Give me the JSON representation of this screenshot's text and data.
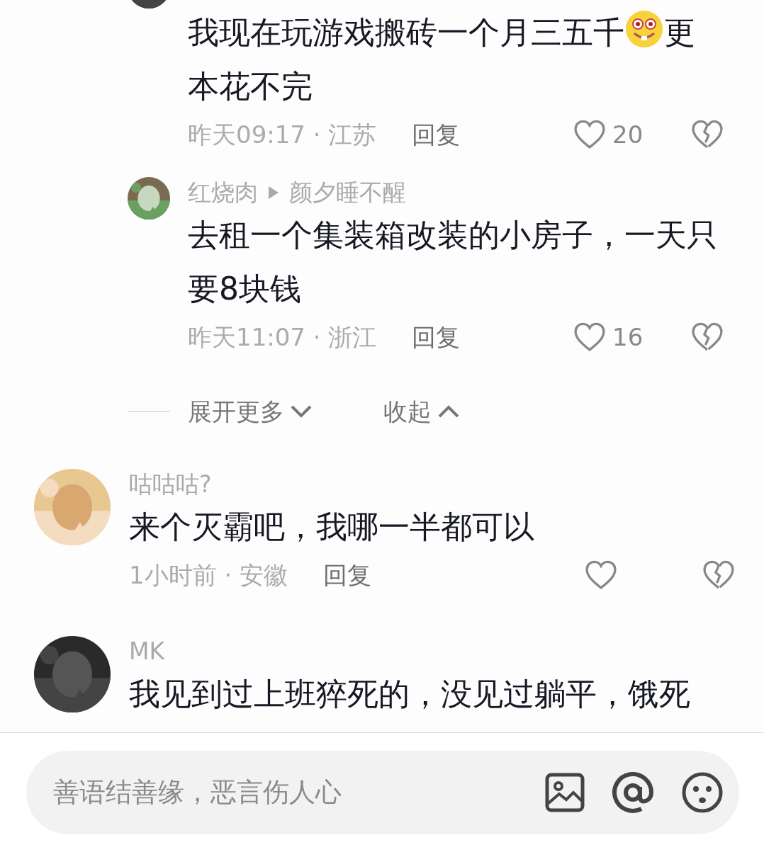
{
  "comments": [
    {
      "kind": "reply",
      "segments": [
        {
          "kind": "text",
          "text": "我现在玩游戏搬砖一个月三五千"
        },
        {
          "kind": "emoji"
        },
        {
          "kind": "text",
          "text": "更本花不完"
        }
      ],
      "time_place": "昨天09:17 · 江苏",
      "reply_label": "回复",
      "likes": "20"
    },
    {
      "kind": "reply",
      "author": "红烧肉",
      "reply_to": "颜夕睡不醒",
      "segments": [
        {
          "kind": "text",
          "text": "去租一个集装箱改装的小房子，一天只要8块钱"
        }
      ],
      "time_place": "昨天11:07 · 浙江",
      "reply_label": "回复",
      "likes": "16"
    },
    {
      "kind": "controls",
      "expand": "展开更多",
      "collapse": "收起"
    },
    {
      "kind": "top",
      "author": "咕咕咕?",
      "segments": [
        {
          "kind": "text",
          "text": "来个灭霸吧，我哪一半都可以"
        }
      ],
      "time_place": "1小时前 · 安徽",
      "reply_label": "回复"
    },
    {
      "kind": "top",
      "author": "MK",
      "segments": [
        {
          "kind": "text",
          "text": "我见到过上班猝死的，没见过躺平，饿死"
        }
      ]
    }
  ],
  "composer": {
    "placeholder": "善语结善缘，恶言伤人心"
  }
}
